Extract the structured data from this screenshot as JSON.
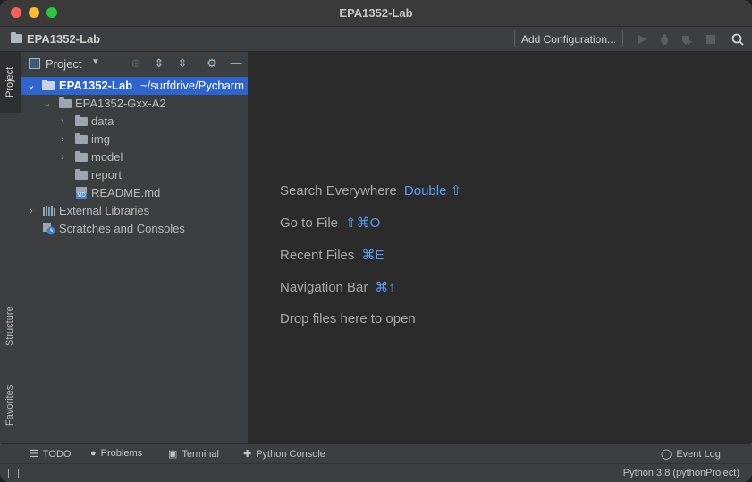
{
  "window": {
    "title": "EPA1352-Lab"
  },
  "navbar": {
    "project": "EPA1352-Lab",
    "add_config": "Add Configuration..."
  },
  "left_strip": {
    "tabs": [
      "Project",
      "Structure",
      "Favorites"
    ]
  },
  "project_panel": {
    "title": "Project",
    "tree": [
      {
        "name": "EPA1352-Lab",
        "path": "~/surfdrive/Pycharm"
      },
      {
        "name": "EPA1352-Gxx-A2"
      },
      {
        "name": "data"
      },
      {
        "name": "img"
      },
      {
        "name": "model"
      },
      {
        "name": "report"
      },
      {
        "name": "README.md"
      },
      {
        "name": "External Libraries"
      },
      {
        "name": "Scratches and Consoles"
      }
    ]
  },
  "editor": {
    "hints": [
      {
        "label": "Search Everywhere",
        "key": "Double ⇧"
      },
      {
        "label": "Go to File",
        "key": "⇧⌘O"
      },
      {
        "label": "Recent Files",
        "key": "⌘E"
      },
      {
        "label": "Navigation Bar",
        "key": "⌘↑"
      },
      {
        "label": "Drop files here to open",
        "key": ""
      }
    ]
  },
  "bottom_bar": {
    "todo": "TODO",
    "problems": "Problems",
    "terminal": "Terminal",
    "python_console": "Python Console",
    "event_log": "Event Log"
  },
  "status_bar": {
    "interpreter": "Python 3.8 (pythonProject)"
  },
  "colors": {
    "selection": "#2f65ca",
    "accent_key": "#589df6"
  }
}
